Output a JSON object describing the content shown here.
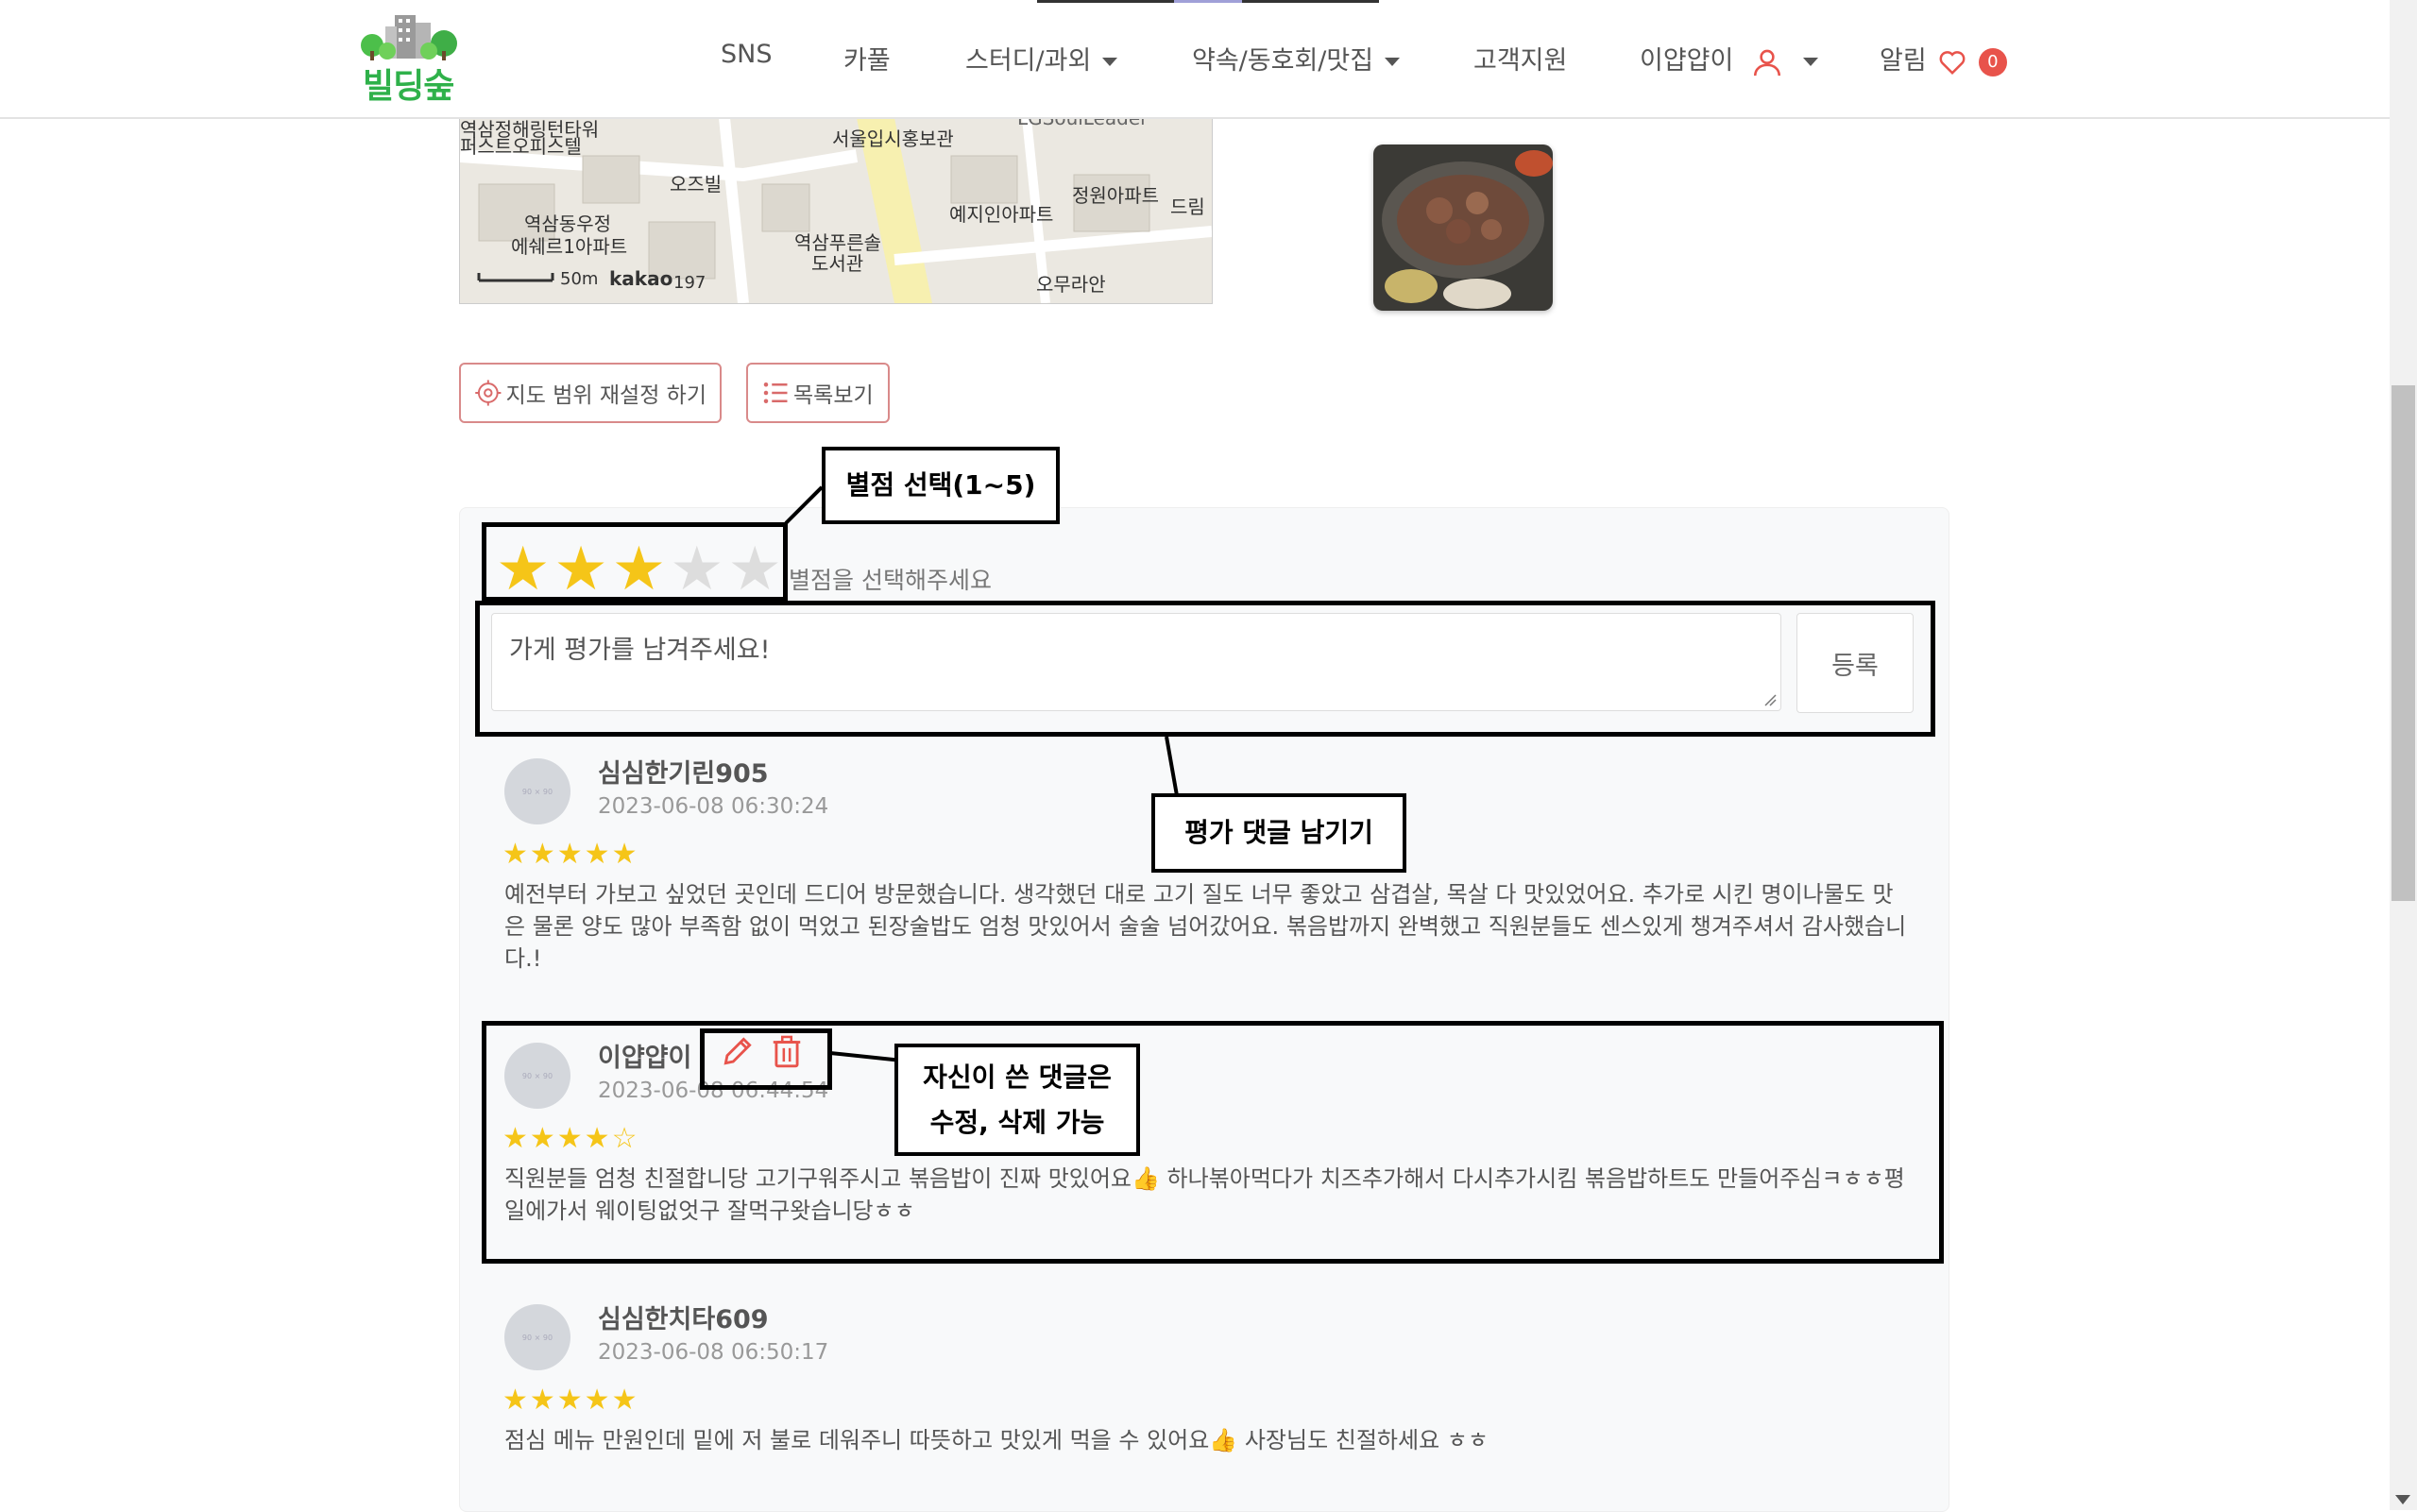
{
  "nav": {
    "logo_text": "빌딩숲",
    "items": [
      {
        "label": "SNS",
        "has_caret": false
      },
      {
        "label": "카풀",
        "has_caret": false
      },
      {
        "label": "스터디/과외",
        "has_caret": true
      },
      {
        "label": "약속/동호회/맛집",
        "has_caret": true
      },
      {
        "label": "고객지원",
        "has_caret": false
      },
      {
        "label": "이얍얍이",
        "has_caret": true
      },
      {
        "label": "알림",
        "has_caret": false
      }
    ],
    "notification_count": "0"
  },
  "map": {
    "labels": [
      "역삼정해링턴타워",
      "퍼스트오피스텔",
      "서울입시홍보관",
      "오즈빌",
      "정원아파트",
      "예지인아파트",
      "드림",
      "역삼동우정",
      "에쉐르1아파트",
      "역삼푸른솔",
      "도서관",
      "오무라안",
      "LGSoulLeader"
    ],
    "scale": "50m",
    "brand": "kakao",
    "address_fragment": "197"
  },
  "buttons": {
    "reset_map": "지도 범위 재설정 하기",
    "list_view": "목록보기"
  },
  "review_form": {
    "rating": 3,
    "rating_hint": "별점을 선택해주세요",
    "placeholder": "가게 평가를 남겨주세요!",
    "submit": "등록"
  },
  "comments": [
    {
      "name": "심심한기린905",
      "date": "2023-06-08 06:30:24",
      "rating": 5,
      "text": "예전부터 가보고 싶었던 곳인데 드디어 방문했습니다. 생각했던 대로 고기 질도 너무 좋았고 삼겹살, 목살 다 맛있었어요. 추가로 시킨 명이나물도 맛은 물론 양도 많아 부족함 없이 먹었고 된장술밥도 엄청 맛있어서 술술 넘어갔어요. 볶음밥까지 완벽했고 직원분들도 센스있게 챙겨주셔서 감사했습니다.!",
      "own": false
    },
    {
      "name": "이얍얍이",
      "date": "2023-06-08 06:44:54",
      "rating": 4,
      "text": "직원분들 엄청 친절합니당 고기구워주시고 볶음밥이 진짜 맛있어요👍 하나볶아먹다가 치즈추가해서 다시추가시킴 볶음밥하트도 만들어주심ㅋㅎㅎ평일에가서 웨이팅없엇구 잘먹구왓습니당ㅎㅎ",
      "own": true
    },
    {
      "name": "심심한치타609",
      "date": "2023-06-08 06:50:17",
      "rating": 5,
      "text": "점심 메뉴 만원인데 밑에 저 불로 데워주니 따뜻하고 맛있게 먹을 수 있어요👍 사장님도 친절하세요 ㅎㅎ",
      "own": false
    }
  ],
  "avatar_placeholder": "90 × 90",
  "annotations": {
    "rating_select": "별점 선택(1~5)",
    "leave_review": "평가 댓글 남기기",
    "own_comment_line1": "자신이 쓴 댓글은",
    "own_comment_line2": "수정, 삭제 가능"
  },
  "colors": {
    "brand_green": "#2fb14a",
    "star": "#f5c518",
    "accent_red": "#e8534b"
  }
}
